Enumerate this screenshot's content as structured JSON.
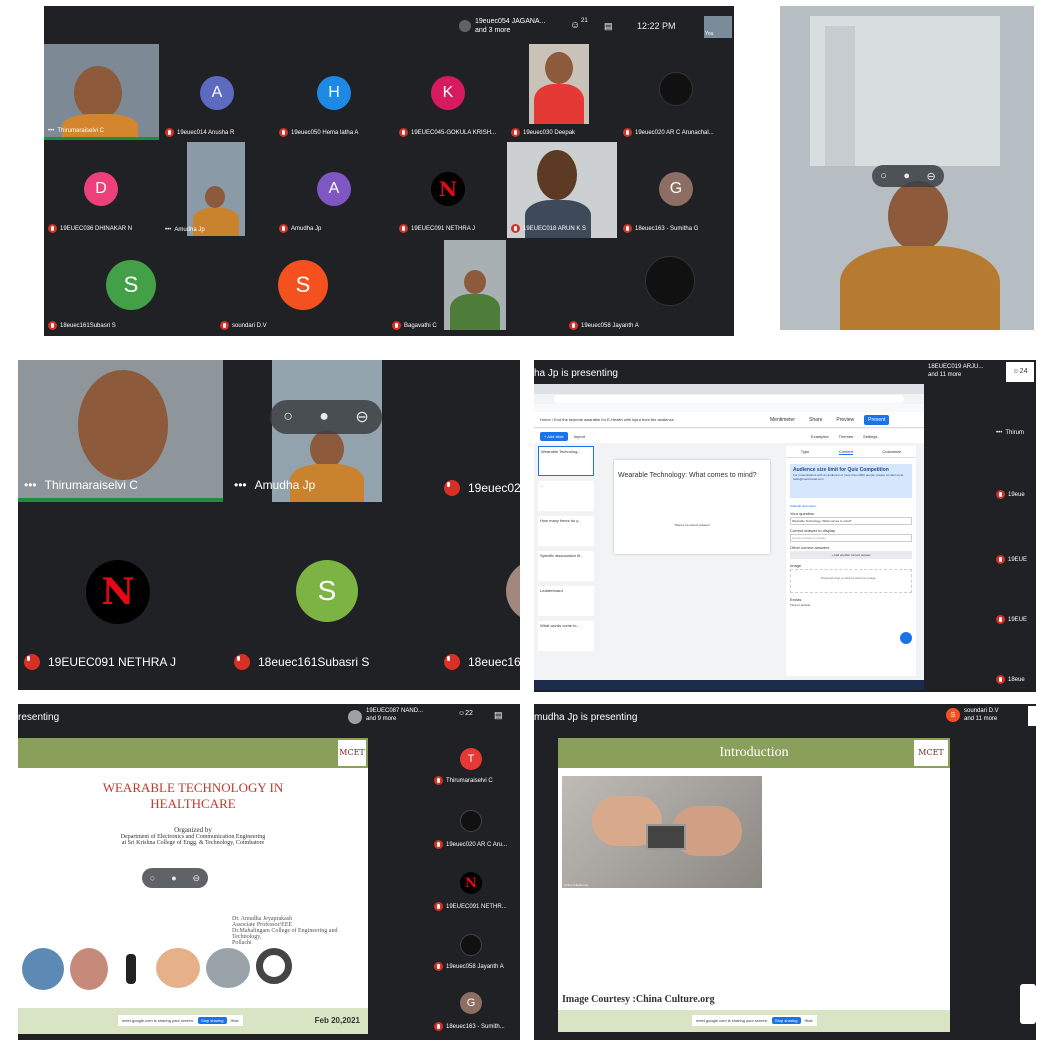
{
  "panel1": {
    "topbar": {
      "participant_name": "19euec054 JAGANA...",
      "participant_more": "and 3 more",
      "people_count": "21",
      "time": "12:22 PM",
      "self_label": "You"
    },
    "tiles": [
      {
        "name": "Thirumaraiselvi C",
        "kind": "video"
      },
      {
        "name": "19euec014 Anusha R",
        "initial": "A",
        "color": "#5c6bc0"
      },
      {
        "name": "19euec050 Hema latha A",
        "initial": "H",
        "color": "#1e88e5"
      },
      {
        "name": "19EUEC045-GOKULA KRISH...",
        "initial": "K",
        "color": "#d81b60"
      },
      {
        "name": "19euec030 Deepak",
        "kind": "video"
      },
      {
        "name": "19euec020 AR C Arunachal...",
        "kind": "avatar-img"
      },
      {
        "name": "19EUEC036 DHINAKAR N",
        "initial": "D",
        "color": "#ec407a"
      },
      {
        "name": "Amudha Jp",
        "kind": "video"
      },
      {
        "name": "Amudha Jp",
        "initial": "A",
        "color": "#7e57c2"
      },
      {
        "name": "19EUEC091 NETHRA J",
        "kind": "netflix"
      },
      {
        "name": "19EUEC018 ARUN K S",
        "kind": "video"
      },
      {
        "name": "18euec163 - Sumitha G",
        "initial": "G",
        "color": "#8d6e63"
      },
      {
        "name": "18euec161Subasri S",
        "initial": "S",
        "color": "#43a047"
      },
      {
        "name": "soundari D.V",
        "initial": "S",
        "color": "#f4511e"
      },
      {
        "name": "Bagavathi C",
        "kind": "video"
      },
      {
        "name": "19euec058 Jayanth A",
        "kind": "avatar-img"
      }
    ]
  },
  "panel3": {
    "tiles": [
      {
        "name": "Thirumaraiselvi C"
      },
      {
        "name": "Amudha Jp"
      },
      {
        "name": "19euec02"
      },
      {
        "name": "19EUEC091 NETHRA J"
      },
      {
        "name": "18euec161Subasri S",
        "initial": "S"
      },
      {
        "name": "18euec16"
      }
    ]
  },
  "panel4": {
    "presenting": "ha Jp is presenting",
    "participant_name": "18EUEC019 ARJU...",
    "participant_more": "and 11 more",
    "people_count": "24",
    "mentimeter": {
      "breadcrumb": "Home / End the keynote wearable for E-Health with input from the audience",
      "presentation_name": "Mentimeter",
      "share": "Share",
      "preview": "Preview",
      "present": "Present",
      "add_slide": "+ Add slide",
      "import": "Import",
      "examples": "Examples",
      "themes": "Themes",
      "settings": "Settings",
      "slides": [
        "Wearable Technolog...",
        "...",
        "How many times do y...",
        "Specific dissociation fil...",
        "Leaderboard",
        "What words come to..."
      ],
      "question": "Wearable Technology: What comes to mind?",
      "no_correct": "There's no correct answer!",
      "tabs": [
        "Type",
        "Content",
        "Customize"
      ],
      "limit_title": "Audience size limit for Quiz Competition",
      "limit_text": "For presentations with an audience of more than 2000 people, please contact us at hello@mentimeter.com",
      "add_description": "Add/edit description",
      "your_question_label": "Your question",
      "your_question_value": "Wearable Technology: What comes to mind?",
      "correct_answer_label": "Correct answer to display",
      "correct_answer_placeholder": "Correct answer to display",
      "other_correct_label": "Other correct answers",
      "add_another": "+ Add another correct answer",
      "image_label": "Image",
      "image_hint": "Drag and drop or click to select an image",
      "extras_label": "Extras",
      "time_label": "Time to answer"
    },
    "side": [
      "Thirum",
      "19eue",
      "19EUE",
      "19EUE",
      "18eue"
    ]
  },
  "panel5": {
    "presenting": "resenting",
    "participant_name": "19EUEC087 NAND...",
    "participant_more": "and 9 more",
    "people_count": "22",
    "slide": {
      "title": "WEARABLE TECHNOLOGY IN HEALTHCARE",
      "organized_by": "Organized by",
      "dept": "Department of Electronics and Communication Engineering",
      "college": "at Sri Krishna College of Engg. & Technology, Coimbatore",
      "speaker": "Dr. Amudha Jeyaprakash",
      "designation": "Associate Professor/EEE",
      "speaker_college": "Dr.Mahalingam College of Engineering and Technology,",
      "place": "Pollachi",
      "date": "Feb 20,2021",
      "logo": "MCET"
    },
    "share_notice": "meet.google.com is sharing your screen.",
    "stop_sharing": "Stop sharing",
    "hide": "Hide",
    "side": [
      {
        "name": "Thirumaraiselvi C",
        "initial": "T",
        "color": "#e53935"
      },
      {
        "name": "19euec020 AR C Aru..."
      },
      {
        "name": "19EUEC091 NETHR..."
      },
      {
        "name": "19euec058 Jayanth A"
      },
      {
        "name": "18euec163 - Sumith...",
        "initial": "G",
        "color": "#8d6e63"
      }
    ]
  },
  "panel6": {
    "presenting": "mudha Jp is presenting",
    "participant_name": "soundari D.V",
    "participant_more": "and 11 more",
    "participant_initial": "S",
    "slide": {
      "title": "Introduction",
      "courtesy": "Image Courtesy :China Culture.org",
      "logo": "MCET",
      "image_caption": "China Culture.org"
    },
    "share_notice": "meet.google.com is sharing your screen.",
    "stop_sharing": "Stop sharing",
    "hide": "Hide"
  },
  "colors": {
    "meet_bg": "#202124",
    "slide_green": "#8aa05a",
    "slide_title_red": "#c0392b",
    "accent_blue": "#1a73e8",
    "mic_red": "#d93025"
  }
}
